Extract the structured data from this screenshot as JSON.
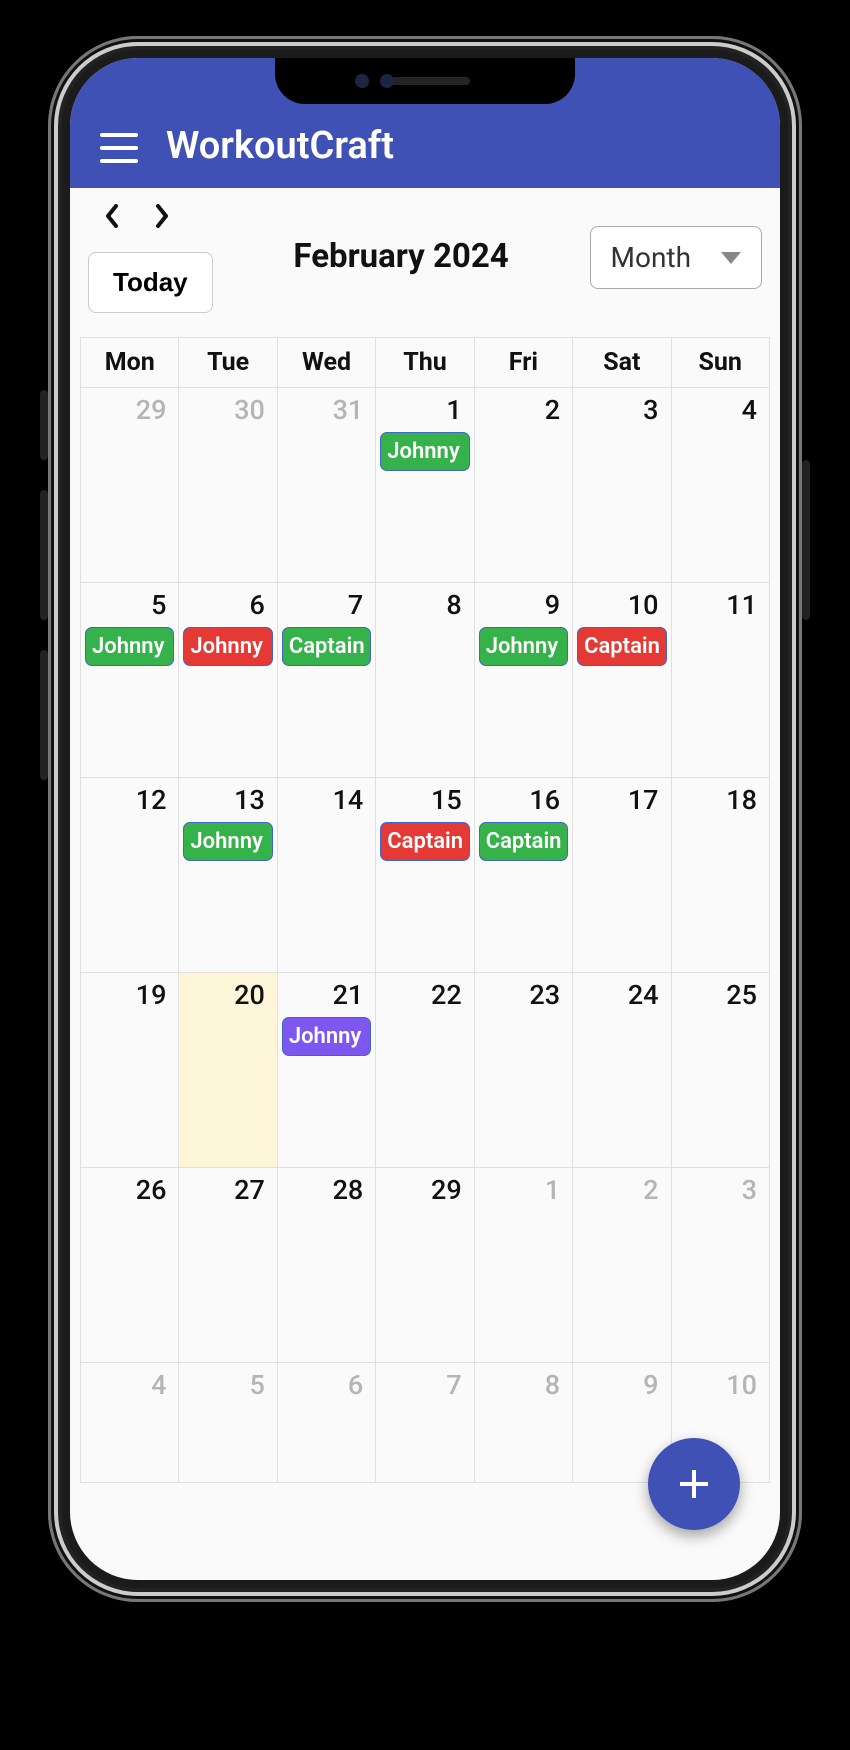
{
  "app_title": "WorkoutCraft",
  "controls": {
    "today_label": "Today",
    "month_title": "February 2024",
    "view_label": "Month"
  },
  "dow": [
    "Mon",
    "Tue",
    "Wed",
    "Thu",
    "Fri",
    "Sat",
    "Sun"
  ],
  "colors": {
    "green": "#36b24a",
    "red": "#e53935",
    "purple": "#7e57f0",
    "accent": "#3f51b5"
  },
  "weeks": [
    [
      {
        "n": "29",
        "other": true,
        "events": []
      },
      {
        "n": "30",
        "other": true,
        "events": []
      },
      {
        "n": "31",
        "other": true,
        "events": []
      },
      {
        "n": "1",
        "events": [
          {
            "label": "Johnny",
            "color": "green"
          }
        ]
      },
      {
        "n": "2",
        "events": []
      },
      {
        "n": "3",
        "events": []
      },
      {
        "n": "4",
        "events": []
      }
    ],
    [
      {
        "n": "5",
        "events": [
          {
            "label": "Johnny",
            "color": "green"
          }
        ]
      },
      {
        "n": "6",
        "events": [
          {
            "label": "Johnny",
            "color": "red"
          }
        ]
      },
      {
        "n": "7",
        "events": [
          {
            "label": "Captain",
            "color": "green"
          }
        ]
      },
      {
        "n": "8",
        "events": []
      },
      {
        "n": "9",
        "events": [
          {
            "label": "Johnny",
            "color": "green"
          }
        ]
      },
      {
        "n": "10",
        "events": [
          {
            "label": "Captain",
            "color": "red"
          }
        ]
      },
      {
        "n": "11",
        "events": []
      }
    ],
    [
      {
        "n": "12",
        "events": []
      },
      {
        "n": "13",
        "events": [
          {
            "label": "Johnny",
            "color": "green"
          }
        ]
      },
      {
        "n": "14",
        "events": []
      },
      {
        "n": "15",
        "events": [
          {
            "label": "Captain",
            "color": "red"
          }
        ]
      },
      {
        "n": "16",
        "events": [
          {
            "label": "Captain",
            "color": "green"
          }
        ]
      },
      {
        "n": "17",
        "events": []
      },
      {
        "n": "18",
        "events": []
      }
    ],
    [
      {
        "n": "19",
        "events": []
      },
      {
        "n": "20",
        "today": true,
        "events": []
      },
      {
        "n": "21",
        "events": [
          {
            "label": "Johnny",
            "color": "purple"
          }
        ]
      },
      {
        "n": "22",
        "events": []
      },
      {
        "n": "23",
        "events": []
      },
      {
        "n": "24",
        "events": []
      },
      {
        "n": "25",
        "events": []
      }
    ],
    [
      {
        "n": "26",
        "events": []
      },
      {
        "n": "27",
        "events": []
      },
      {
        "n": "28",
        "events": []
      },
      {
        "n": "29",
        "events": []
      },
      {
        "n": "1",
        "other": true,
        "events": []
      },
      {
        "n": "2",
        "other": true,
        "events": []
      },
      {
        "n": "3",
        "other": true,
        "events": []
      }
    ],
    [
      {
        "n": "4",
        "other": true,
        "events": []
      },
      {
        "n": "5",
        "other": true,
        "events": []
      },
      {
        "n": "6",
        "other": true,
        "events": []
      },
      {
        "n": "7",
        "other": true,
        "events": []
      },
      {
        "n": "8",
        "other": true,
        "events": []
      },
      {
        "n": "9",
        "other": true,
        "events": []
      },
      {
        "n": "10",
        "other": true,
        "events": []
      }
    ]
  ]
}
